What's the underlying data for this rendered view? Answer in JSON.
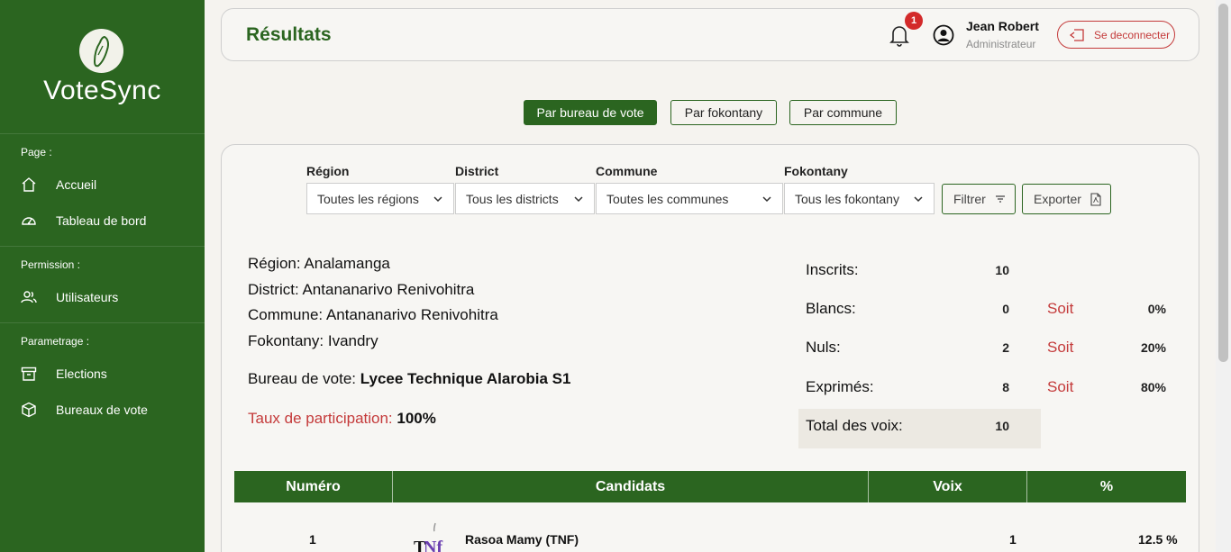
{
  "app": {
    "name": "VoteSync"
  },
  "sidebar": {
    "sections": [
      {
        "title": "Page :",
        "items": [
          {
            "label": "Accueil",
            "icon": "home-icon"
          },
          {
            "label": "Tableau de bord",
            "icon": "gauge-icon"
          }
        ]
      },
      {
        "title": "Permission :",
        "items": [
          {
            "label": "Utilisateurs",
            "icon": "users-icon"
          }
        ]
      },
      {
        "title": "Parametrage :",
        "items": [
          {
            "label": "Elections",
            "icon": "archive-icon"
          },
          {
            "label": "Bureaux de vote",
            "icon": "box-icon"
          }
        ]
      }
    ]
  },
  "header": {
    "title": "Résultats",
    "notifications": "1",
    "user_name": "Jean Robert",
    "user_role": "Administrateur",
    "logout_label": "Se deconnecter"
  },
  "view_tabs": [
    "Par bureau de vote",
    "Par fokontany",
    "Par commune"
  ],
  "filters": {
    "region": {
      "label": "Région",
      "value": "Toutes les régions"
    },
    "district": {
      "label": "District",
      "value": "Tous les districts"
    },
    "commune": {
      "label": "Commune",
      "value": "Toutes les communes"
    },
    "fokontany": {
      "label": "Fokontany",
      "value": "Tous les fokontany"
    },
    "filter_button": "Filtrer",
    "export_button": "Exporter"
  },
  "location": {
    "region_label": "Région:",
    "region": "Analamanga",
    "district_label": "District:",
    "district": "Antananarivo Renivohitra",
    "commune_label": "Commune:",
    "commune": "Antananarivo Renivohitra",
    "fokontany_label": "Fokontany:",
    "fokontany": "Ivandry",
    "bureau_label": "Bureau de vote:",
    "bureau": "Lycee Technique Alarobia S1",
    "participation_label": "Taux de participation:",
    "participation": "100%"
  },
  "stats": {
    "inscrits": {
      "label": "Inscrits:",
      "value": "10"
    },
    "blancs": {
      "label": "Blancs:",
      "value": "0",
      "soit": "Soit",
      "pct": "0%"
    },
    "nuls": {
      "label": "Nuls:",
      "value": "2",
      "soit": "Soit",
      "pct": "20%"
    },
    "exprimes": {
      "label": "Exprimés:",
      "value": "8",
      "soit": "Soit",
      "pct": "80%"
    },
    "total": {
      "label": "Total des voix:",
      "value": "10"
    }
  },
  "table": {
    "headers": [
      "Numéro",
      "Candidats",
      "Voix",
      "%"
    ],
    "rows": [
      {
        "numero": "1",
        "logo": "TNF",
        "candidat": "Rasoa Mamy (TNF)",
        "voix": "1",
        "pct": "12.5 %"
      }
    ]
  },
  "colors": {
    "primary": "#2b6520",
    "danger": "#c43a3a"
  }
}
